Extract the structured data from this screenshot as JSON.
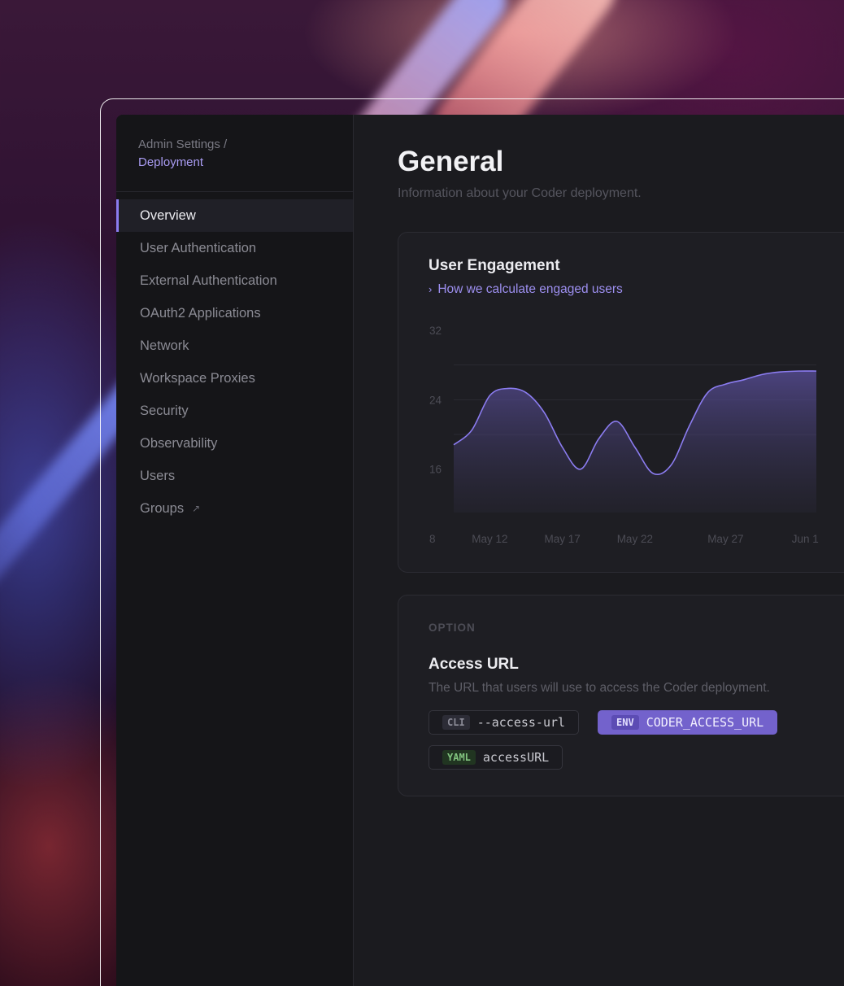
{
  "sidebar": {
    "breadcrumb_root": "Admin Settings /",
    "breadcrumb_current": "Deployment",
    "items": [
      {
        "label": "Overview",
        "active": true
      },
      {
        "label": "User Authentication"
      },
      {
        "label": "External Authentication"
      },
      {
        "label": "OAuth2 Applications"
      },
      {
        "label": "Network"
      },
      {
        "label": "Workspace Proxies"
      },
      {
        "label": "Security"
      },
      {
        "label": "Observability"
      },
      {
        "label": "Users"
      },
      {
        "label": "Groups",
        "icon": "external-link-icon"
      }
    ]
  },
  "main": {
    "title": "General",
    "subtitle": "Information about your Coder deployment."
  },
  "engagement": {
    "title": "User Engagement",
    "link_label": "How we calculate engaged users"
  },
  "chart_data": {
    "type": "area",
    "x": [
      "May 10",
      "May 12",
      "May 14",
      "May 15",
      "May 16",
      "May 17",
      "May 18",
      "May 19",
      "May 21",
      "May 22",
      "May 23",
      "May 24",
      "May 25",
      "May 26",
      "May 27",
      "May 28",
      "May 29",
      "May 30",
      "May 31",
      "Jun 1",
      "Jun 2"
    ],
    "values": [
      18.8,
      20.5,
      24.5,
      25.3,
      24.8,
      22.5,
      18.5,
      16.0,
      19.5,
      21.5,
      18.5,
      15.5,
      16.5,
      21.0,
      24.8,
      25.8,
      26.3,
      26.9,
      27.2,
      27.3,
      27.3
    ],
    "x_ticks": [
      "May 12",
      "May 17",
      "May 22",
      "May 27",
      "Jun 1"
    ],
    "y_ticks": [
      8,
      16,
      24,
      32
    ],
    "ylim": [
      8,
      32
    ],
    "title": "",
    "xlabel": "",
    "ylabel": "",
    "grid": true,
    "line_color": "#8b7cf0"
  },
  "option": {
    "section_label": "OPTION",
    "title": "Access URL",
    "description": "The URL that users will use to access the Coder deployment.",
    "chips": {
      "cli": {
        "tag": "CLI",
        "value": "--access-url"
      },
      "env": {
        "tag": "ENV",
        "value": "CODER_ACCESS_URL"
      },
      "yaml": {
        "tag": "YAML",
        "value": "accessURL"
      }
    }
  },
  "colors": {
    "accent": "#8b7cf0",
    "env_chip": "#7362cc",
    "yaml_tag": "#82c47f"
  }
}
